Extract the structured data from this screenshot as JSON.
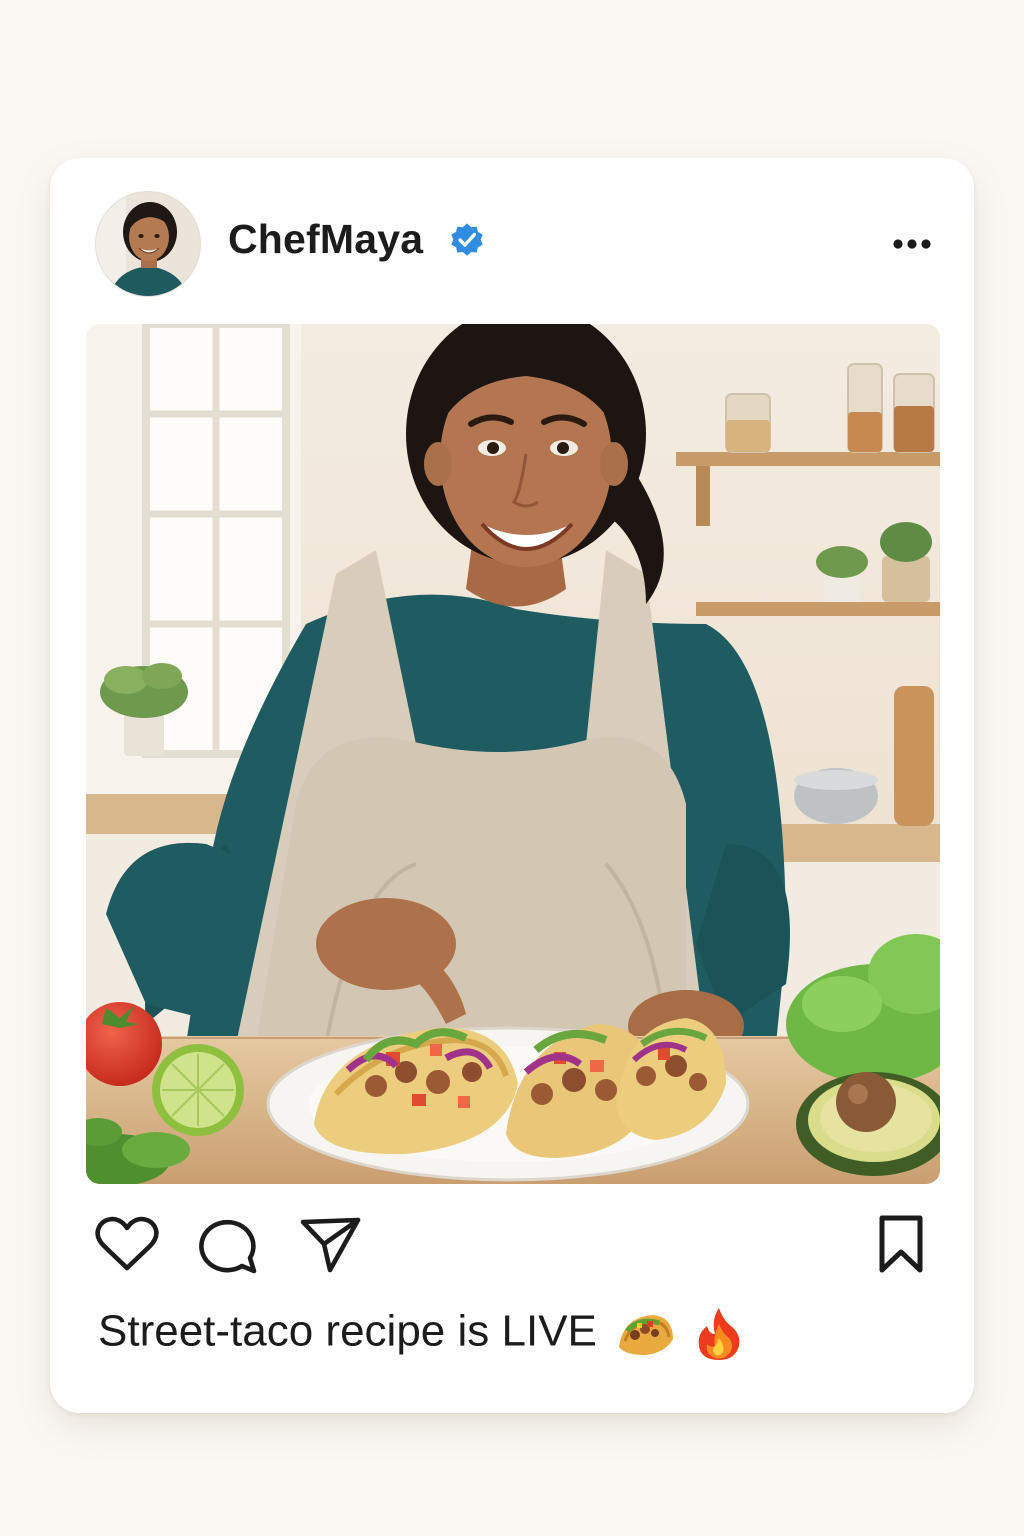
{
  "post": {
    "username": "ChefMaya",
    "verified": true,
    "caption": "Street-taco recipe is LIVE",
    "caption_emojis": [
      "taco-emoji",
      "fire-emoji"
    ],
    "photo_subject": "smiling chef in apron plating tacos in a kitchen",
    "actions": [
      "heart-icon",
      "comment-bubble-icon",
      "paper-plane-icon",
      "bookmark-icon"
    ],
    "menu_icon": "more-options-icon"
  },
  "colors": {
    "page_background": "#fbf8f4",
    "card_background": "#ffffff",
    "text": "#1c1c1c",
    "verified_badge": "#2f8ce0"
  }
}
